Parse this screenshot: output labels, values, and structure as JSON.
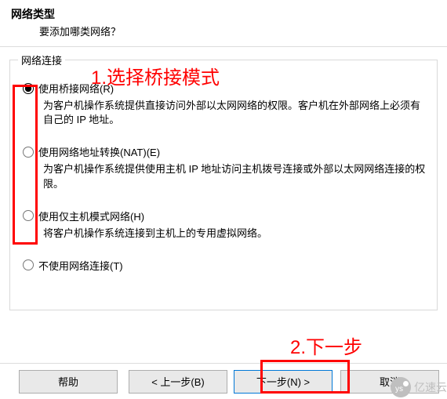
{
  "header": {
    "title": "网络类型",
    "subtitle": "要添加哪类网络？"
  },
  "group": {
    "caption": "网络连接",
    "options": [
      {
        "label": "使用桥接网络(R)",
        "desc": "为客户机操作系统提供直接访问外部以太网网络的权限。客户机在外部网络上必须有自己的 IP 地址。"
      },
      {
        "label": "使用网络地址转换(NAT)(E)",
        "desc": "为客户机操作系统提供使用主机 IP 地址访问主机拨号连接或外部以太网网络连接的权限。"
      },
      {
        "label": "使用仅主机模式网络(H)",
        "desc": "将客户机操作系统连接到主机上的专用虚拟网络。"
      },
      {
        "label": "不使用网络连接(T)",
        "desc": ""
      }
    ]
  },
  "annotations": {
    "a1": "1.选择桥接模式",
    "a2": "2.下一步"
  },
  "buttons": {
    "help": "帮助",
    "back": "< 上一步(B)",
    "next": "下一步(N) >",
    "cancel": "取消"
  },
  "watermark": {
    "text": "亿速云",
    "inner": "ys"
  }
}
